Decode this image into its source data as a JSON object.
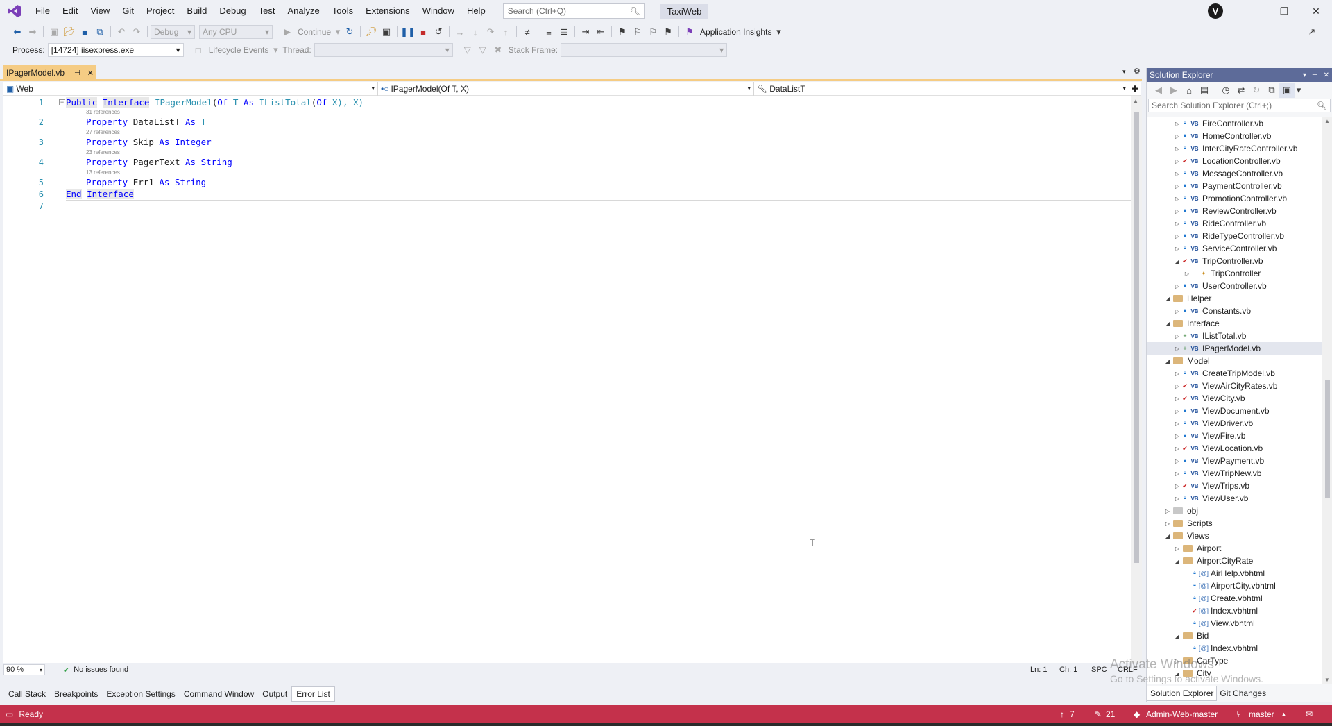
{
  "menu": {
    "items": [
      "File",
      "Edit",
      "View",
      "Git",
      "Project",
      "Build",
      "Debug",
      "Test",
      "Analyze",
      "Tools",
      "Extensions",
      "Window",
      "Help"
    ],
    "search_placeholder": "Search (Ctrl+Q)",
    "solution_name": "TaxiWeb",
    "avatar_initial": "V"
  },
  "toolbar": {
    "config": "Debug",
    "platform": "Any CPU",
    "continue_label": "Continue",
    "app_insights_label": "Application Insights",
    "process_label": "Process:",
    "process_value": "[14724] iisexpress.exe",
    "lifecycle_label": "Lifecycle Events",
    "thread_label": "Thread:",
    "stack_frame_label": "Stack Frame:"
  },
  "editor": {
    "tab_title": "IPagerModel.vb",
    "nav_project": "Web",
    "nav_type": "IPagerModel(Of T, X)",
    "nav_member": "DataListT",
    "lines": [
      {
        "num": "1",
        "refs": ""
      },
      {
        "num": "2",
        "refs": "31 references"
      },
      {
        "num": "3",
        "refs": "27 references"
      },
      {
        "num": "4",
        "refs": "23 references"
      },
      {
        "num": "5",
        "refs": "13 references"
      },
      {
        "num": "6",
        "refs": ""
      },
      {
        "num": "7",
        "refs": ""
      }
    ],
    "code": {
      "l1_public": "Public",
      "l1_interface": "Interface",
      "l1_name": "IPagerModel",
      "l1_rest_a": "(",
      "l1_of": "Of",
      "l1_t": " T ",
      "l1_as": "As",
      "l1_ilist": "IListTotal",
      "l1_rest_b": "(",
      "l1_of2": "Of",
      "l1_rest_c": " X), X)",
      "property_kw": "Property",
      "as_kw": "As",
      "p1_name": "DataListT",
      "p1_type": "T",
      "p2_name": "Skip",
      "p2_type": "Integer",
      "p3_name": "PagerText",
      "p3_type": "String",
      "p4_name": "Err1",
      "p4_type": "String",
      "end_kw": "End",
      "end_interface": "Interface"
    },
    "zoom": "90 %",
    "issues": "No issues found",
    "ln": "Ln: 1",
    "ch": "Ch: 1",
    "spc": "SPC",
    "eol": "CRLF"
  },
  "bottom_tabs": [
    "Call Stack",
    "Breakpoints",
    "Exception Settings",
    "Command Window",
    "Output",
    "Error List"
  ],
  "active_bottom_tab": "Error List",
  "status": {
    "ready": "Ready",
    "up_count": "7",
    "pencil_count": "21",
    "repo": "Admin-Web-master",
    "branch": "master",
    "bg_color": "#c4314b"
  },
  "solution_explorer": {
    "title": "Solution Explorer",
    "search_placeholder": "Search Solution Explorer (Ctrl+;)",
    "tabs": [
      "Solution Explorer",
      "Git Changes"
    ],
    "tree": [
      {
        "label": "FireController.vb",
        "kind": "vb",
        "status": "lock",
        "exp": "collapsed",
        "indent": 3
      },
      {
        "label": "HomeController.vb",
        "kind": "vb",
        "status": "lock",
        "exp": "collapsed",
        "indent": 3
      },
      {
        "label": "InterCityRateController.vb",
        "kind": "vb",
        "status": "lock",
        "exp": "collapsed",
        "indent": 3
      },
      {
        "label": "LocationController.vb",
        "kind": "vb",
        "status": "check",
        "exp": "collapsed",
        "indent": 3
      },
      {
        "label": "MessageController.vb",
        "kind": "vb",
        "status": "lock",
        "exp": "collapsed",
        "indent": 3
      },
      {
        "label": "PaymentController.vb",
        "kind": "vb",
        "status": "lock",
        "exp": "collapsed",
        "indent": 3
      },
      {
        "label": "PromotionController.vb",
        "kind": "vb",
        "status": "lock",
        "exp": "collapsed",
        "indent": 3
      },
      {
        "label": "ReviewController.vb",
        "kind": "vb",
        "status": "lock",
        "exp": "collapsed",
        "indent": 3
      },
      {
        "label": "RideController.vb",
        "kind": "vb",
        "status": "lock",
        "exp": "collapsed",
        "indent": 3
      },
      {
        "label": "RideTypeController.vb",
        "kind": "vb",
        "status": "lock",
        "exp": "collapsed",
        "indent": 3
      },
      {
        "label": "ServiceController.vb",
        "kind": "vb",
        "status": "lock",
        "exp": "collapsed",
        "indent": 3
      },
      {
        "label": "TripController.vb",
        "kind": "vb",
        "status": "check",
        "exp": "expanded",
        "indent": 3
      },
      {
        "label": "TripController",
        "kind": "class",
        "status": "",
        "exp": "collapsed",
        "indent": 4
      },
      {
        "label": "UserController.vb",
        "kind": "vb",
        "status": "lock",
        "exp": "collapsed",
        "indent": 3
      },
      {
        "label": "Helper",
        "kind": "folder",
        "status": "",
        "exp": "expanded",
        "indent": 2
      },
      {
        "label": "Constants.vb",
        "kind": "vb",
        "status": "lock",
        "exp": "collapsed",
        "indent": 3
      },
      {
        "label": "Interface",
        "kind": "folder",
        "status": "",
        "exp": "expanded",
        "indent": 2
      },
      {
        "label": "IListTotal.vb",
        "kind": "vb",
        "status": "plus",
        "exp": "collapsed",
        "indent": 3
      },
      {
        "label": "IPagerModel.vb",
        "kind": "vb",
        "status": "plus",
        "exp": "collapsed",
        "indent": 3,
        "selected": true
      },
      {
        "label": "Model",
        "kind": "folder",
        "status": "",
        "exp": "expanded",
        "indent": 2
      },
      {
        "label": "CreateTripModel.vb",
        "kind": "vb",
        "status": "lock",
        "exp": "collapsed",
        "indent": 3
      },
      {
        "label": "ViewAirCityRates.vb",
        "kind": "vb",
        "status": "check",
        "exp": "collapsed",
        "indent": 3
      },
      {
        "label": "ViewCity.vb",
        "kind": "vb",
        "status": "check",
        "exp": "collapsed",
        "indent": 3
      },
      {
        "label": "ViewDocument.vb",
        "kind": "vb",
        "status": "lock",
        "exp": "collapsed",
        "indent": 3
      },
      {
        "label": "ViewDriver.vb",
        "kind": "vb",
        "status": "lock",
        "exp": "collapsed",
        "indent": 3
      },
      {
        "label": "ViewFire.vb",
        "kind": "vb",
        "status": "lock",
        "exp": "collapsed",
        "indent": 3
      },
      {
        "label": "ViewLocation.vb",
        "kind": "vb",
        "status": "check",
        "exp": "collapsed",
        "indent": 3
      },
      {
        "label": "ViewPayment.vb",
        "kind": "vb",
        "status": "lock",
        "exp": "collapsed",
        "indent": 3
      },
      {
        "label": "ViewTripNew.vb",
        "kind": "vb",
        "status": "lock",
        "exp": "collapsed",
        "indent": 3
      },
      {
        "label": "ViewTrips.vb",
        "kind": "vb",
        "status": "check",
        "exp": "collapsed",
        "indent": 3
      },
      {
        "label": "ViewUser.vb",
        "kind": "vb",
        "status": "lock",
        "exp": "collapsed",
        "indent": 3
      },
      {
        "label": "obj",
        "kind": "folder-grey",
        "status": "",
        "exp": "collapsed",
        "indent": 2
      },
      {
        "label": "Scripts",
        "kind": "folder",
        "status": "",
        "exp": "collapsed",
        "indent": 2
      },
      {
        "label": "Views",
        "kind": "folder",
        "status": "",
        "exp": "expanded",
        "indent": 2
      },
      {
        "label": "Airport",
        "kind": "folder",
        "status": "",
        "exp": "collapsed",
        "indent": 3
      },
      {
        "label": "AirportCityRate",
        "kind": "folder",
        "status": "",
        "exp": "expanded",
        "indent": 3
      },
      {
        "label": "AirHelp.vbhtml",
        "kind": "vbhtml",
        "status": "lock",
        "exp": "",
        "indent": 4
      },
      {
        "label": "AirportCity.vbhtml",
        "kind": "vbhtml",
        "status": "lock",
        "exp": "",
        "indent": 4
      },
      {
        "label": "Create.vbhtml",
        "kind": "vbhtml",
        "status": "lock",
        "exp": "",
        "indent": 4
      },
      {
        "label": "Index.vbhtml",
        "kind": "vbhtml",
        "status": "check",
        "exp": "",
        "indent": 4
      },
      {
        "label": "View.vbhtml",
        "kind": "vbhtml",
        "status": "lock",
        "exp": "",
        "indent": 4
      },
      {
        "label": "Bid",
        "kind": "folder",
        "status": "",
        "exp": "expanded",
        "indent": 3
      },
      {
        "label": "Index.vbhtml",
        "kind": "vbhtml",
        "status": "lock",
        "exp": "",
        "indent": 4
      },
      {
        "label": "CarType",
        "kind": "folder",
        "status": "",
        "exp": "collapsed",
        "indent": 3
      },
      {
        "label": "City",
        "kind": "folder",
        "status": "",
        "exp": "expanded",
        "indent": 3
      }
    ]
  },
  "watermark": {
    "line1": "Activate Windows",
    "line2": "Go to Settings to activate Windows."
  }
}
